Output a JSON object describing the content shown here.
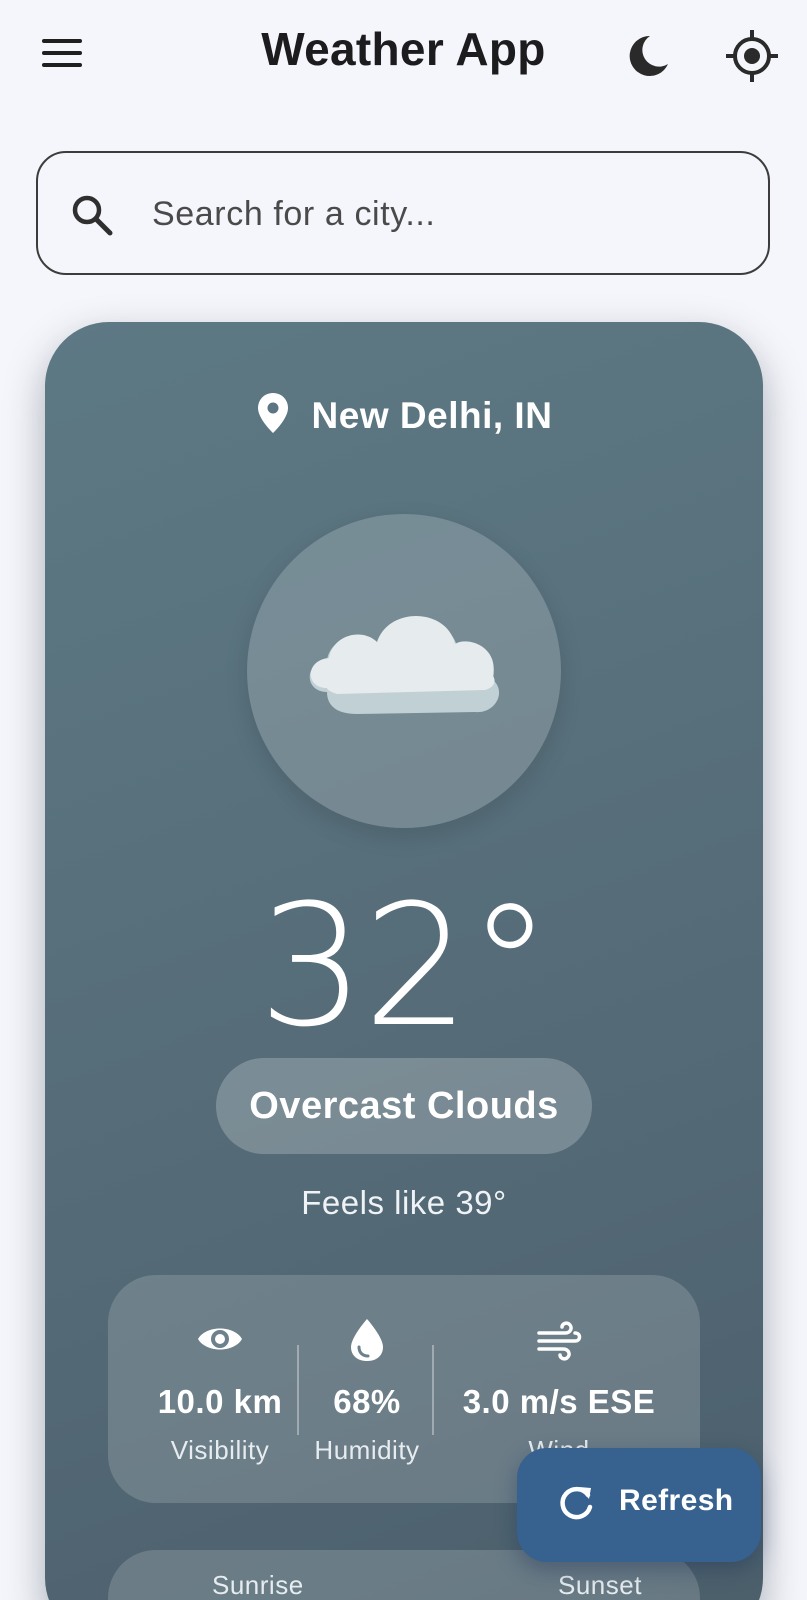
{
  "header": {
    "title": "Weather App",
    "menu_icon": "hamburger-menu-icon",
    "theme_icon": "moon-icon",
    "location_icon": "gps-crosshair-icon"
  },
  "search": {
    "placeholder": "Search for a city...",
    "icon": "search-icon"
  },
  "current": {
    "location": "New Delhi, IN",
    "temperature": "32°",
    "condition": "Overcast Clouds",
    "feels_like": "Feels like 39°",
    "weather_icon": "overcast-cloud-icon"
  },
  "stats": [
    {
      "icon": "eye-icon",
      "value": "10.0 km",
      "label": "Visibility"
    },
    {
      "icon": "water-drop-icon",
      "value": "68%",
      "label": "Humidity"
    },
    {
      "icon": "wind-icon",
      "value": "3.0 m/s ESE",
      "label": "Wind"
    }
  ],
  "sun": {
    "sunrise_label": "Sunrise",
    "sunset_label": "Sunset"
  },
  "fab": {
    "label": "Refresh",
    "icon": "refresh-icon"
  },
  "colors": {
    "background": "#f5f6fb",
    "card": "#566d79",
    "fab": "#37618f"
  }
}
